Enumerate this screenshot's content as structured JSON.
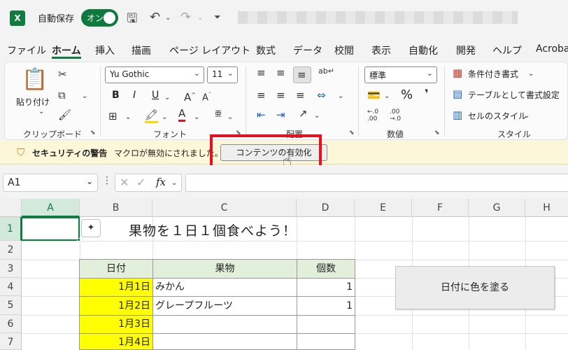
{
  "titlebar": {
    "logo": "X",
    "autosave_label": "自動保存",
    "toggle_label": "オン",
    "icons": [
      "save-icon",
      "undo-icon",
      "redo-icon",
      "customize-icon"
    ]
  },
  "tabs": [
    "ファイル",
    "ホーム",
    "挿入",
    "描画",
    "ページ レイアウト",
    "数式",
    "データ",
    "校閲",
    "表示",
    "自動化",
    "開発",
    "ヘルプ",
    "Acroba"
  ],
  "active_tab": "ホーム",
  "ribbon": {
    "clipboard": {
      "paste_label": "貼り付け",
      "group_label": "クリップボード"
    },
    "font": {
      "font_name": "Yu Gothic",
      "font_size": "11",
      "group_label": "フォント",
      "bold": "B",
      "italic": "I",
      "underline": "U"
    },
    "alignment": {
      "group_label": "配置"
    },
    "number": {
      "format": "標準",
      "group_label": "数値",
      "percent": "%"
    },
    "styles": {
      "conditional": "条件付き書式",
      "table": "テーブルとして書式設定",
      "cell_styles": "セルのスタイル",
      "group_label": "スタイル"
    }
  },
  "security_bar": {
    "title": "セキュリティの警告",
    "message": "マクロが無効にされました。",
    "button_label": "コンテンツの有効化"
  },
  "formula_bar": {
    "name_box": "A1",
    "fx": "fx",
    "value": ""
  },
  "sheet": {
    "columns": [
      "A",
      "B",
      "C",
      "D",
      "E",
      "F",
      "G",
      "H"
    ],
    "rows": [
      "1",
      "2",
      "3",
      "4",
      "5",
      "6",
      "7"
    ],
    "title": "果物を１日１個食べよう！",
    "table_headers": [
      "日付",
      "果物",
      "個数"
    ],
    "table_rows": [
      {
        "date": "1月1日",
        "fruit": "みかん",
        "count": "1"
      },
      {
        "date": "1月2日",
        "fruit": "グレープフルーツ",
        "count": "1"
      },
      {
        "date": "1月3日",
        "fruit": "",
        "count": ""
      },
      {
        "date": "1月4日",
        "fruit": "",
        "count": ""
      }
    ],
    "macro_button": "日付に色を塗る"
  },
  "colors": {
    "accent": "#107c41",
    "highlight": "#ffff00",
    "header_fill": "#e2efda",
    "alert_red": "#e8101c"
  }
}
